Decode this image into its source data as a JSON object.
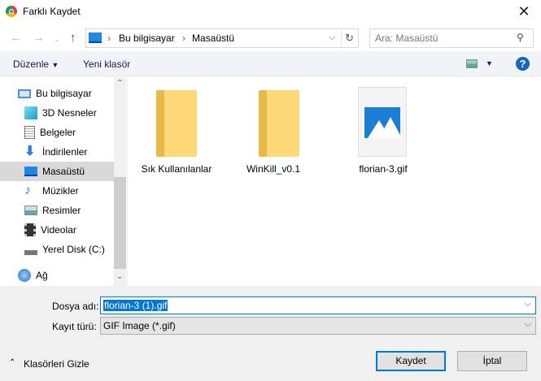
{
  "window": {
    "title": "Farklı Kaydet",
    "close": "✕"
  },
  "address": {
    "crumbs": [
      "Bu bilgisayar",
      "Masaüstü"
    ],
    "search_placeholder": "Ara: Masaüstü"
  },
  "toolbar": {
    "organize": "Düzenle",
    "new_folder": "Yeni klasör",
    "help": "?"
  },
  "nav": {
    "items": [
      {
        "label": "Bu bilgisayar",
        "icon": "computer-icon"
      },
      {
        "label": "3D Nesneler",
        "icon": "cube-icon"
      },
      {
        "label": "Belgeler",
        "icon": "document-icon"
      },
      {
        "label": "İndirilenler",
        "icon": "download-icon"
      },
      {
        "label": "Masaüstü",
        "icon": "desktop-icon",
        "selected": true
      },
      {
        "label": "Müzikler",
        "icon": "music-icon"
      },
      {
        "label": "Resimler",
        "icon": "pictures-icon"
      },
      {
        "label": "Videolar",
        "icon": "video-icon"
      },
      {
        "label": "Yerel Disk (C:)",
        "icon": "disk-icon"
      },
      {
        "label": "Ağ",
        "icon": "network-icon"
      }
    ]
  },
  "files": [
    {
      "name": "Sık Kullanılanlar",
      "type": "folder"
    },
    {
      "name": "WinKill_v0.1",
      "type": "folder"
    },
    {
      "name": "florian-3.gif",
      "type": "image"
    }
  ],
  "form": {
    "filename_label": "Dosya adı:",
    "filename_value": "florian-3 (1).gif",
    "type_label": "Kayıt türü:",
    "type_value": "GIF Image (*.gif)"
  },
  "footer": {
    "hide_folders": "Klasörleri Gizle",
    "save": "Kaydet",
    "cancel": "İptal"
  }
}
